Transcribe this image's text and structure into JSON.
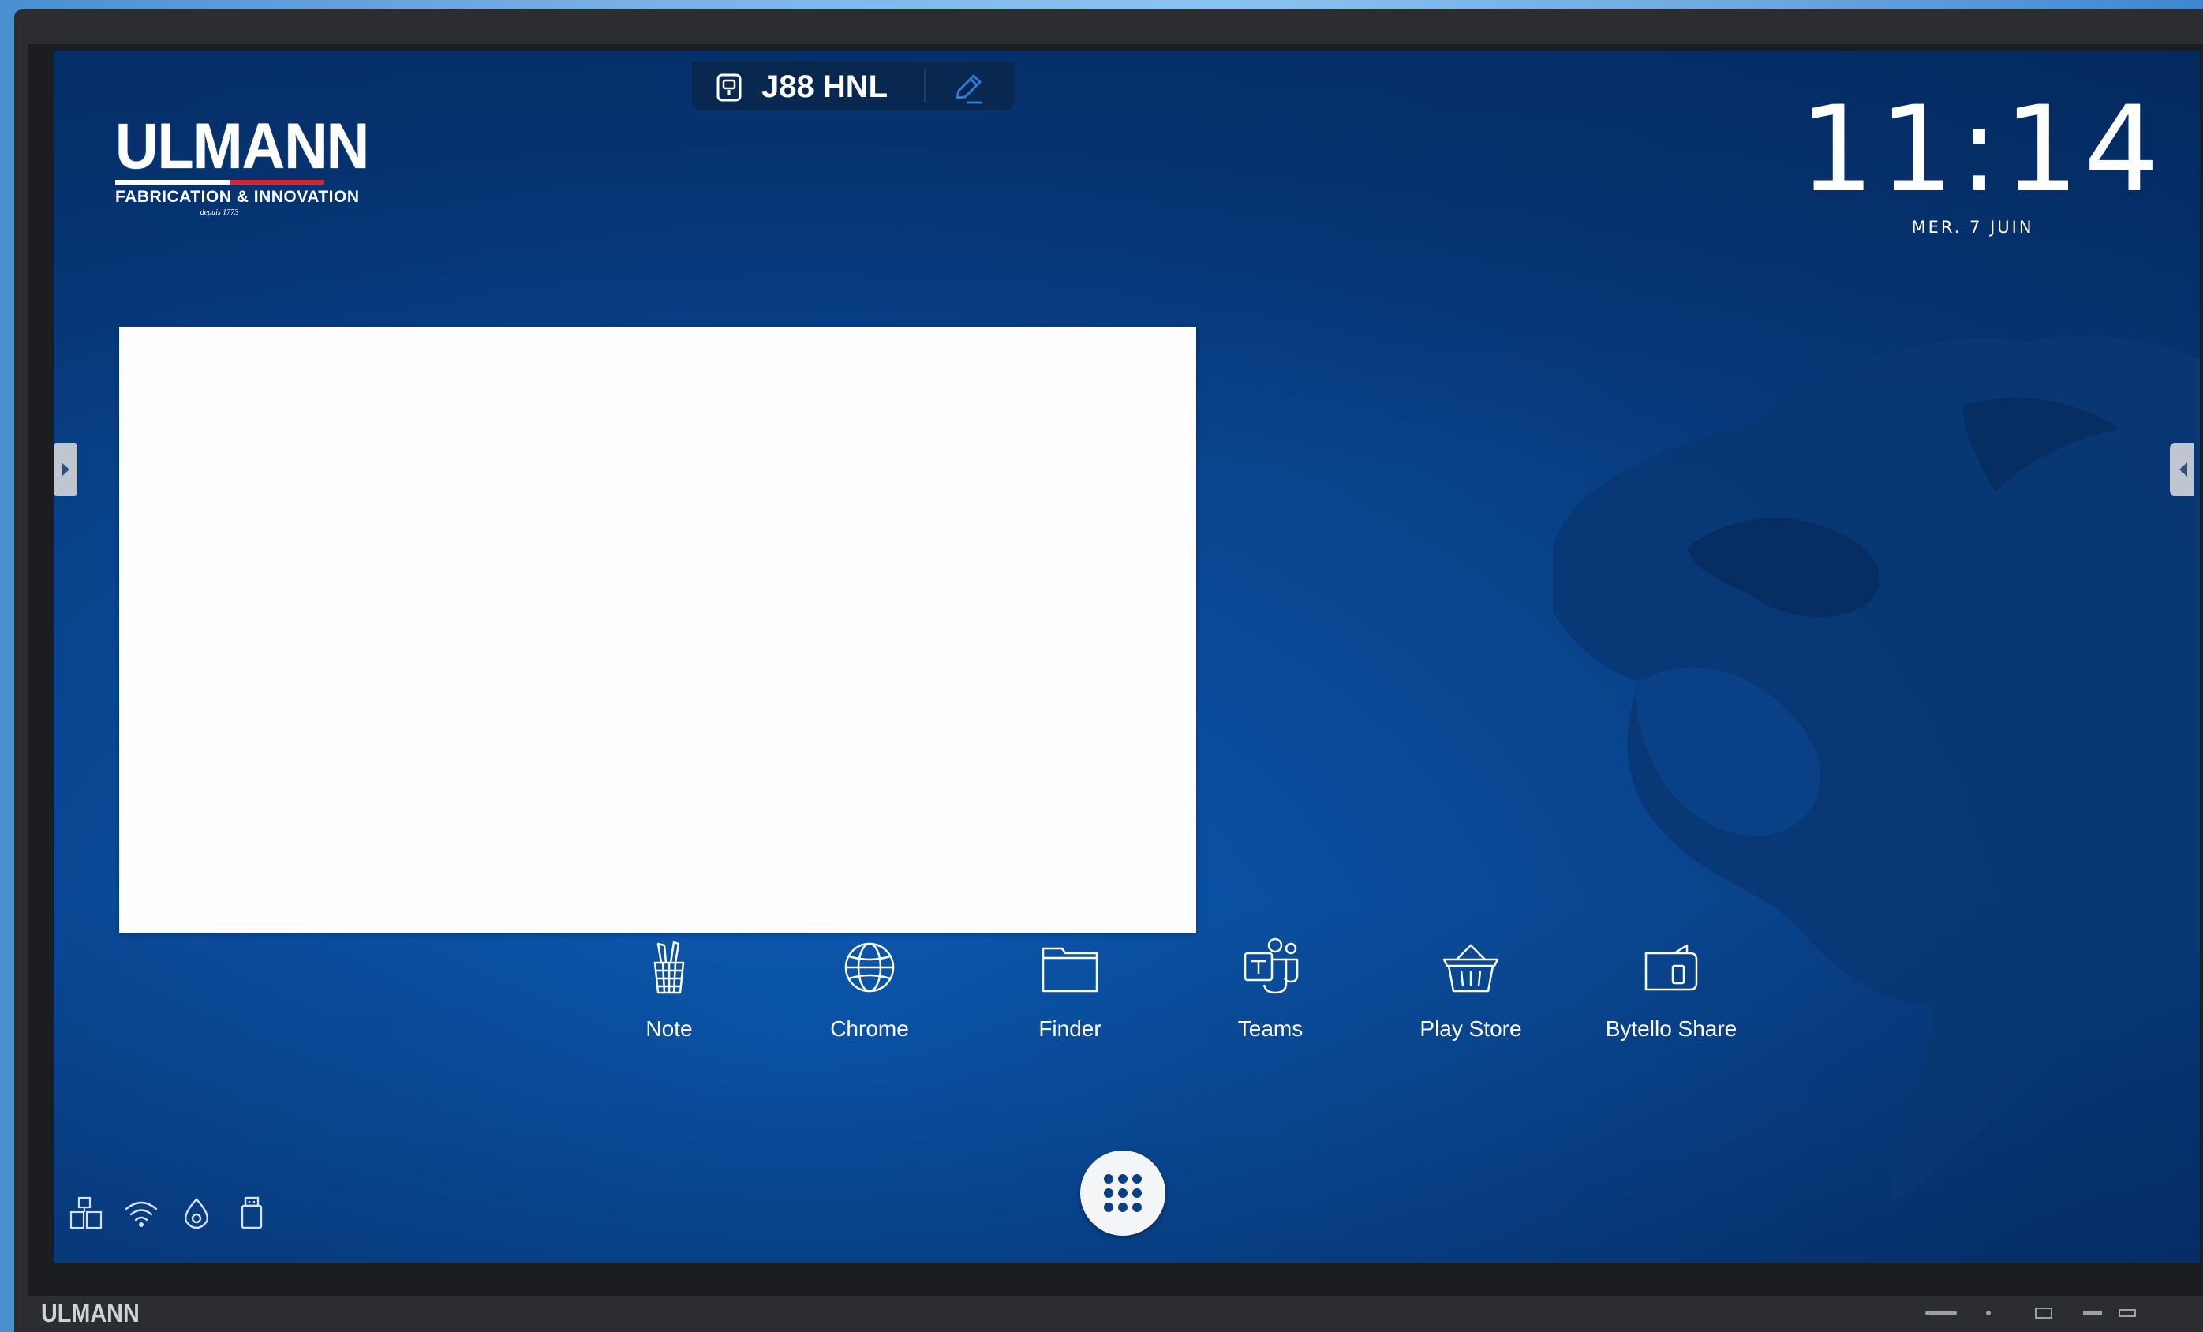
{
  "device": {
    "name": "J88 HNL",
    "brand_strip": "ULMANN"
  },
  "brand": {
    "name": "ULMANN",
    "tagline": "FABRICATION & INNOVATION",
    "since": "depuis 1773",
    "accent_color": "#d7262d"
  },
  "clock": {
    "time": "11:14",
    "date": "MER. 7 JUIN"
  },
  "apps": [
    {
      "label": "Note",
      "icon": "note-pencil-cup-icon"
    },
    {
      "label": "Chrome",
      "icon": "globe-icon"
    },
    {
      "label": "Finder",
      "icon": "folder-icon"
    },
    {
      "label": "Teams",
      "icon": "teams-icon"
    },
    {
      "label": "Play Store",
      "icon": "basket-icon"
    },
    {
      "label": "Bytello Share",
      "icon": "screen-share-icon"
    }
  ],
  "status_icons": [
    "input-source-icon",
    "wifi-icon",
    "hotspot-icon",
    "usb-icon"
  ],
  "colors": {
    "screen_background": "#0a4a98",
    "pill_background": "#08284f",
    "widget_background": "#fefefe"
  }
}
